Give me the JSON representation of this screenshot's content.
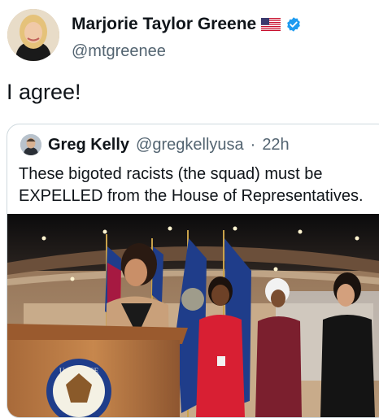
{
  "author": {
    "display_name": "Marjorie Taylor Greene",
    "handle": "@mtgreenee",
    "flag_icon": "us-flag-icon",
    "verified_icon": "verified-badge-icon",
    "verified_color": "#1d9bf0"
  },
  "tweet": {
    "text": "I agree!"
  },
  "quoted": {
    "display_name": "Greg Kelly",
    "handle": "@gregkellyusa",
    "separator": "·",
    "time": "22h",
    "text": "These bigoted racists (the squad) must be EXPELLED from the House of Representatives.",
    "seal_text": "U.S. HOUSE OF REPRESENTATIVES"
  }
}
